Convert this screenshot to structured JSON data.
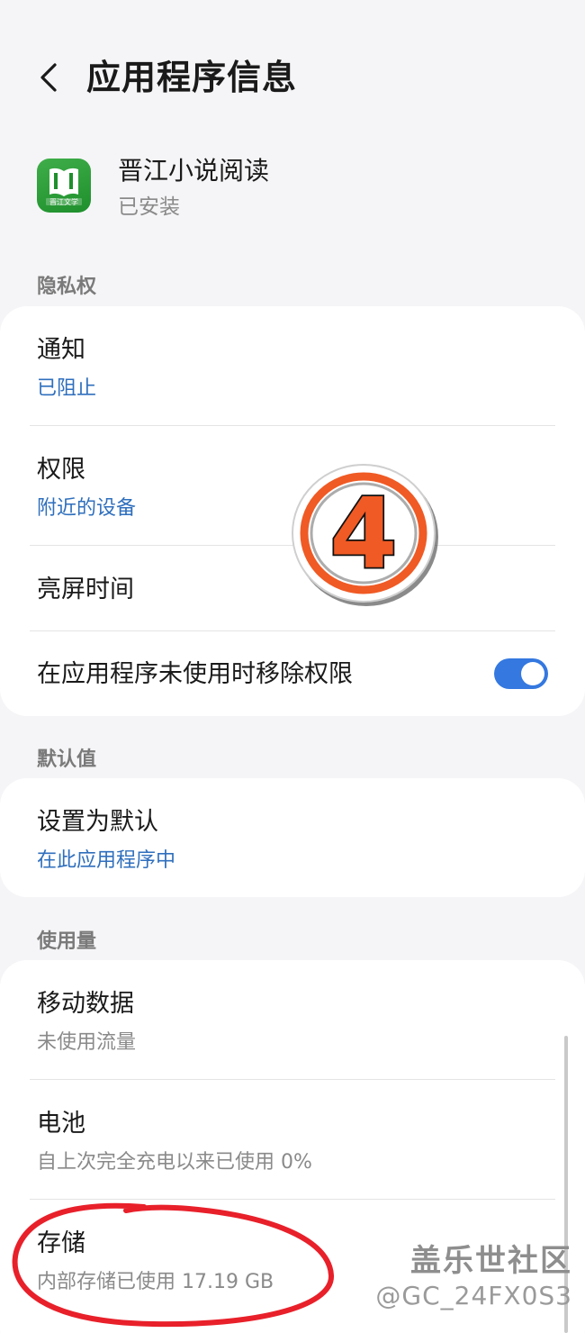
{
  "header": {
    "title": "应用程序信息"
  },
  "app": {
    "name": "晋江小说阅读",
    "status": "已安装",
    "icon_text": "晋江文学"
  },
  "privacy": {
    "label": "隐私权",
    "notifications": {
      "title": "通知",
      "sub": "已阻止"
    },
    "permissions": {
      "title": "权限",
      "sub": "附近的设备"
    },
    "screen_time": {
      "title": "亮屏时间"
    },
    "remove_permissions": {
      "title": "在应用程序未使用时移除权限",
      "toggle_on": true
    }
  },
  "defaults": {
    "label": "默认值",
    "set_default": {
      "title": "设置为默认",
      "sub": "在此应用程序中"
    }
  },
  "usage": {
    "label": "使用量",
    "mobile_data": {
      "title": "移动数据",
      "sub": "未使用流量"
    },
    "battery": {
      "title": "电池",
      "sub": "自上次完全充电以来已使用 0%"
    },
    "storage": {
      "title": "存储",
      "sub": "内部存储已使用 17.19 GB"
    }
  },
  "overlay": {
    "step_number": "4",
    "watermark_brand": "盖乐世社区",
    "watermark_user": "@GC_24FX0S3"
  },
  "colors": {
    "accent_blue": "#3478e0",
    "link_blue": "#2f6fbd",
    "badge_orange": "#f05a24",
    "annotation_red": "#e8202a"
  }
}
